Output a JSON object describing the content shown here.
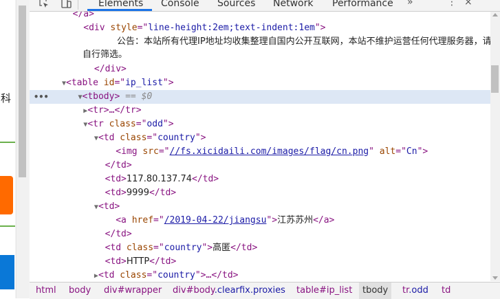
{
  "page": {
    "left_text": "百科"
  },
  "devtools": {
    "tabs": [
      {
        "label": "Elements"
      },
      {
        "label": "Console"
      },
      {
        "label": "Sources"
      },
      {
        "label": "Network"
      },
      {
        "label": "Performance"
      }
    ],
    "more_tabs": "»",
    "menu_glyph": "⋮",
    "close_glyph": "×",
    "tree": {
      "r0": {
        "open": "</a>"
      },
      "r1": {
        "tag": "div",
        "attr": "style",
        "val": "line-height:2em;text-indent:1em"
      },
      "notice_text": "公告：本站所有代理IP地址均收集整理自国内公开互联网，本站不维护运营任何代理服务器，请自行筛选。",
      "r3": {
        "close": "</div>"
      },
      "r4": {
        "tag": "table",
        "attr": "id",
        "val": "ip_list"
      },
      "r5": {
        "tag": "tbody",
        "eq": "== $0"
      },
      "r6": {
        "text": "<tr>…</tr>"
      },
      "r7": {
        "tag": "tr",
        "attr": "class",
        "val": "odd"
      },
      "r8": {
        "tag": "td",
        "attr": "class",
        "val": "country"
      },
      "r9": {
        "tag": "img",
        "attr1": "src",
        "val1": "//fs.xicidaili.com/images/flag/cn.png",
        "attr2": "alt",
        "val2": "Cn"
      },
      "r10": {
        "close": "</td>"
      },
      "r11": {
        "text": "117.80.137.74"
      },
      "r12": {
        "text": "9999"
      },
      "r13": {
        "open": "<td>"
      },
      "r14": {
        "attr": "href",
        "val": "/2019-04-22/jiangsu",
        "text": "江苏苏州"
      },
      "r15": {
        "close": "</td>"
      },
      "r16": {
        "attr": "class",
        "val": "country",
        "text": "高匿"
      },
      "r17": {
        "text": "HTTP"
      },
      "r18": {
        "attr": "class",
        "val": "country",
        "text": "…"
      }
    },
    "breadcrumbs": [
      {
        "tag": "html",
        "suffix": ""
      },
      {
        "tag": "body",
        "suffix": ""
      },
      {
        "tag": "div",
        "suffix": "#wrapper"
      },
      {
        "tag": "div",
        "suffix": "#body",
        "cls": ".clearfix.proxies"
      },
      {
        "tag": "table",
        "suffix": "#ip_list"
      },
      {
        "tag": "tbody",
        "suffix": ""
      },
      {
        "tag": "tr",
        "suffix": "",
        "cls": ".odd"
      },
      {
        "tag": "td",
        "suffix": ""
      }
    ]
  },
  "colors": {
    "accent": "#1a73e8",
    "selected_row": "#dde7f5",
    "tag": "#881280",
    "attr_name": "#994500",
    "attr_value": "#1a1aa6"
  }
}
